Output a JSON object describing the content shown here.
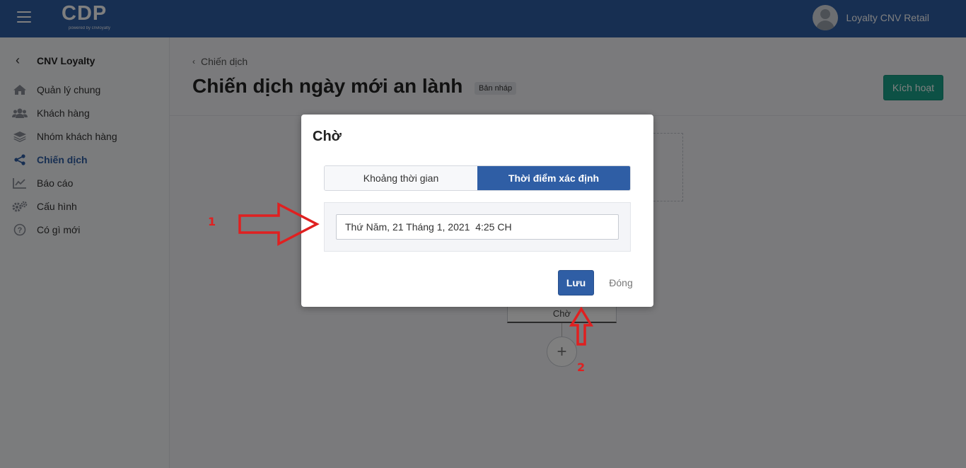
{
  "header": {
    "brand": "CDP",
    "brand_sub": "powered by cnvloyalty",
    "user_name": "Loyalty CNV Retail"
  },
  "sidebar": {
    "back_title": "CNV Loyalty",
    "items": [
      {
        "label": "Quản lý chung",
        "icon": "home-icon"
      },
      {
        "label": "Khách hàng",
        "icon": "users-icon"
      },
      {
        "label": "Nhóm khách hàng",
        "icon": "layers-icon"
      },
      {
        "label": "Chiến dịch",
        "icon": "share-icon",
        "active": true
      },
      {
        "label": "Báo cáo",
        "icon": "chart-line-icon"
      },
      {
        "label": "Cấu hình",
        "icon": "gears-icon"
      },
      {
        "label": "Có gì mới",
        "icon": "question-circle-icon"
      }
    ]
  },
  "main": {
    "breadcrumb": "Chiến dịch",
    "title": "Chiến dịch ngày mới an lành",
    "badge": "Bản nháp",
    "activate_label": "Kích hoạt"
  },
  "canvas": {
    "node_label": "Chờ",
    "add_symbol": "+"
  },
  "modal": {
    "title": "Chờ",
    "tabs": [
      {
        "label": "Khoảng thời gian",
        "active": false
      },
      {
        "label": "Thời điểm xác định",
        "active": true
      }
    ],
    "date_value": "Thứ Năm, 21 Tháng 1, 2021  4:25 CH",
    "save_label": "Lưu",
    "close_label": "Đóng"
  },
  "annotations": {
    "step1": "1",
    "step2": "2",
    "color": "#e02020"
  },
  "colors": {
    "primary": "#2f5ea5",
    "success": "#1aa38a"
  }
}
